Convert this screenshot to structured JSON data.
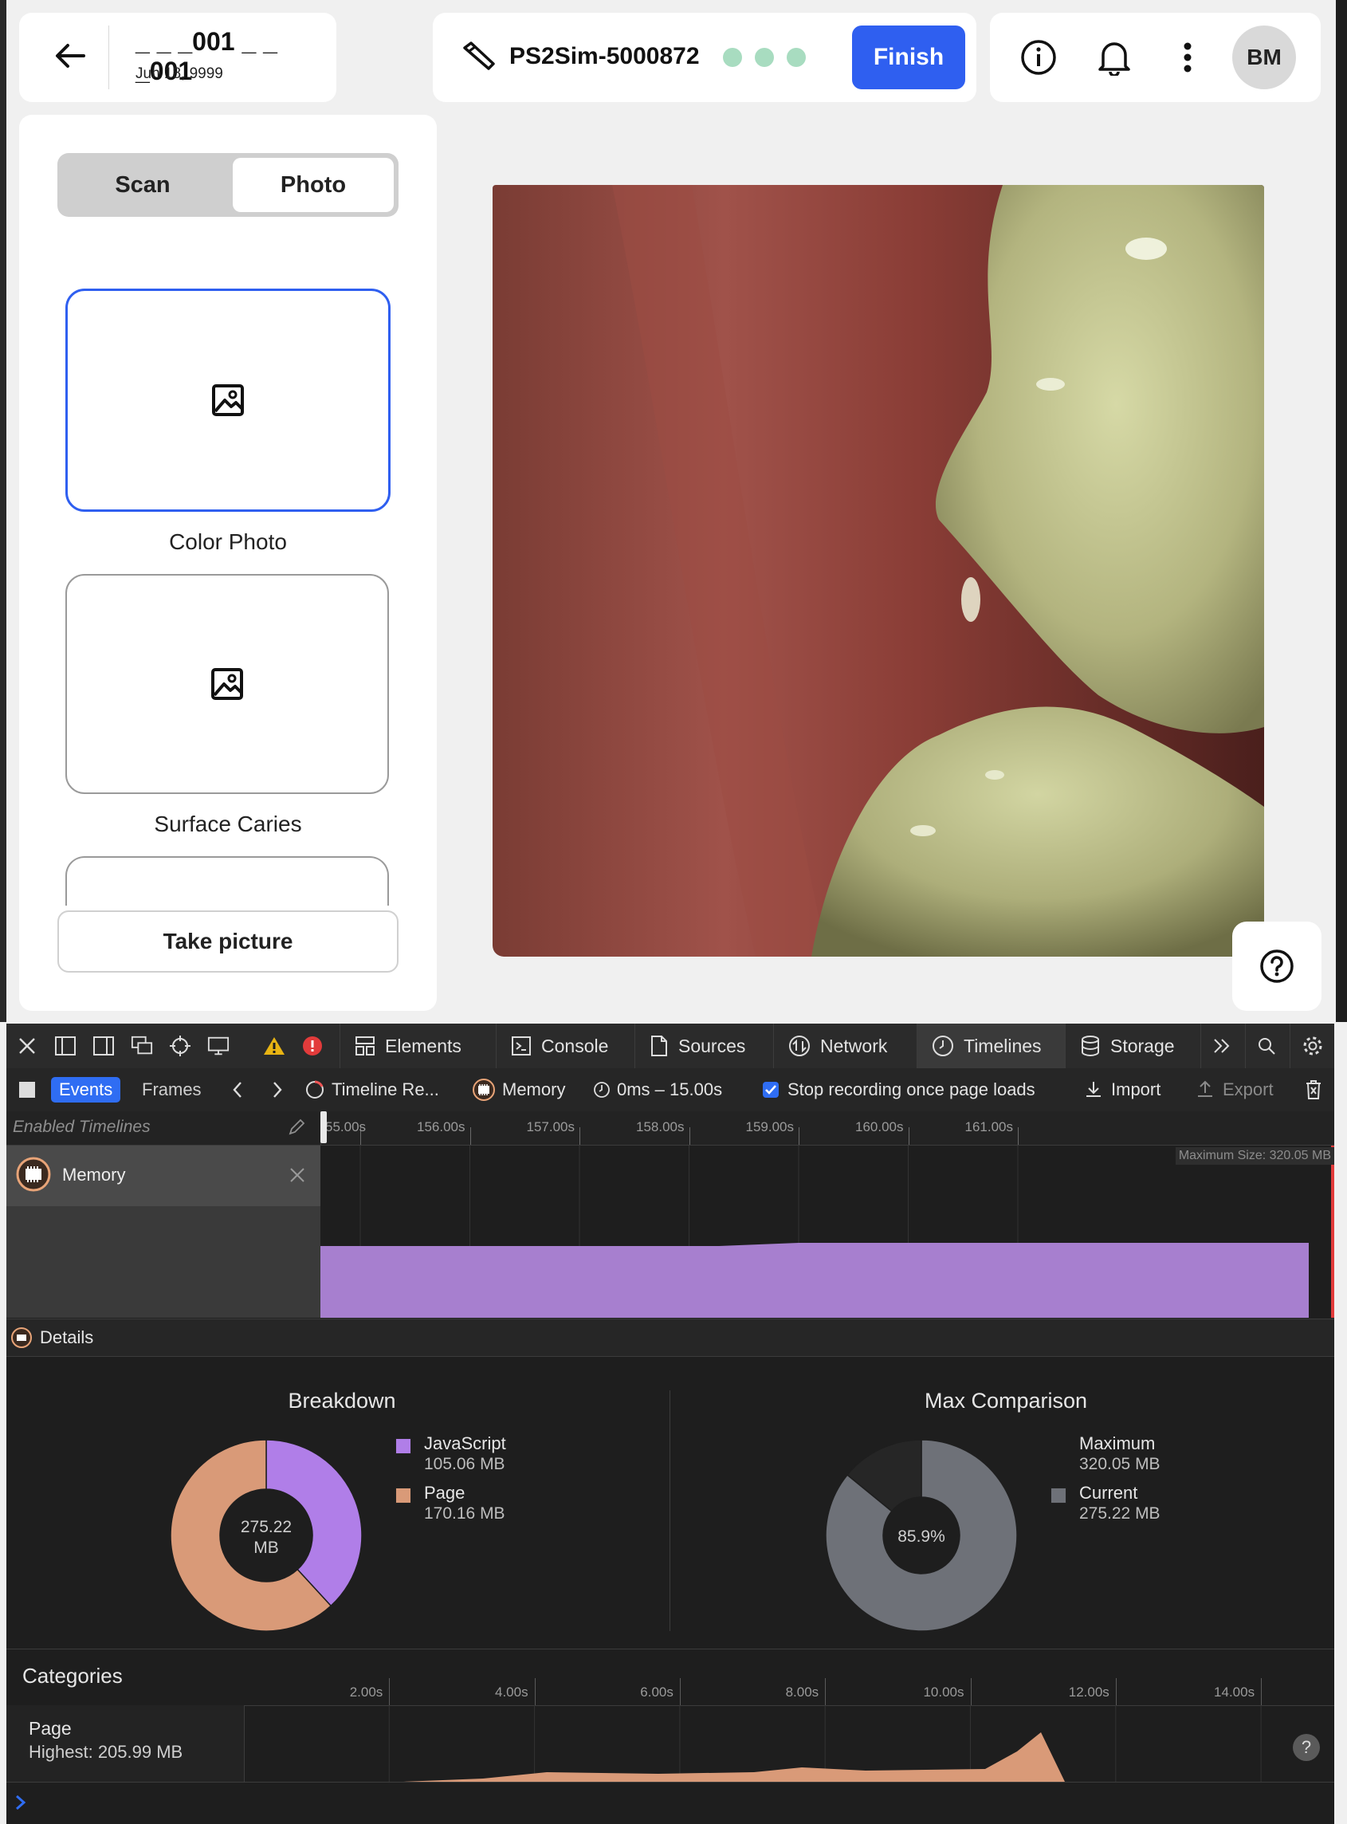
{
  "header": {
    "patient_id": "_ _ _001 _ _ _001",
    "date": "Jun 18, 9999",
    "device_name": "PS2Sim-5000872",
    "finish_label": "Finish",
    "avatar_initials": "BM"
  },
  "capture_panel": {
    "modes": [
      "Scan",
      "Photo"
    ],
    "selected_mode": "Photo",
    "tiles": [
      {
        "label": "Color Photo",
        "selected": true
      },
      {
        "label": "Surface Caries",
        "selected": false
      }
    ],
    "take_picture_label": "Take picture"
  },
  "colors": {
    "accent": "#2f5ff0",
    "status_dot": "#a8dcc0",
    "javascript": "#b07ee8",
    "page": "#d99a78",
    "max_gray": "#6e7178"
  },
  "devtools": {
    "tabs": [
      "Elements",
      "Console",
      "Sources",
      "Network",
      "Timelines",
      "Storage"
    ],
    "active_tab": "Timelines",
    "sub": {
      "events": "Events",
      "frames": "Frames",
      "recording": "Timeline Re...",
      "memory": "Memory",
      "range": "0ms – 15.00s",
      "stop_recording": "Stop recording once page loads",
      "import": "Import",
      "export": "Export"
    },
    "enabled_timelines": "Enabled Timelines",
    "ruler_ticks": [
      "55.00s",
      "156.00s",
      "157.00s",
      "158.00s",
      "159.00s",
      "160.00s",
      "161.00s"
    ],
    "timeline_name": "Memory",
    "max_size": "Maximum Size: 320.05 MB",
    "details_label": "Details",
    "breakdown": {
      "title": "Breakdown",
      "total": "275.22",
      "total_unit": "MB",
      "items": [
        {
          "name": "JavaScript",
          "value": "105.06 MB",
          "mb": 105.06
        },
        {
          "name": "Page",
          "value": "170.16 MB",
          "mb": 170.16
        }
      ]
    },
    "max_comparison": {
      "title": "Max Comparison",
      "percent": "85.9%",
      "fraction": 0.859,
      "maximum_label": "Maximum",
      "maximum_value": "320.05 MB",
      "current_label": "Current",
      "current_value": "275.22 MB"
    },
    "categories": {
      "title": "Categories",
      "ticks": [
        "2.00s",
        "4.00s",
        "6.00s",
        "8.00s",
        "10.00s",
        "12.00s",
        "14.00s"
      ],
      "page_label": "Page",
      "page_highest": "Highest: 205.99 MB"
    }
  }
}
